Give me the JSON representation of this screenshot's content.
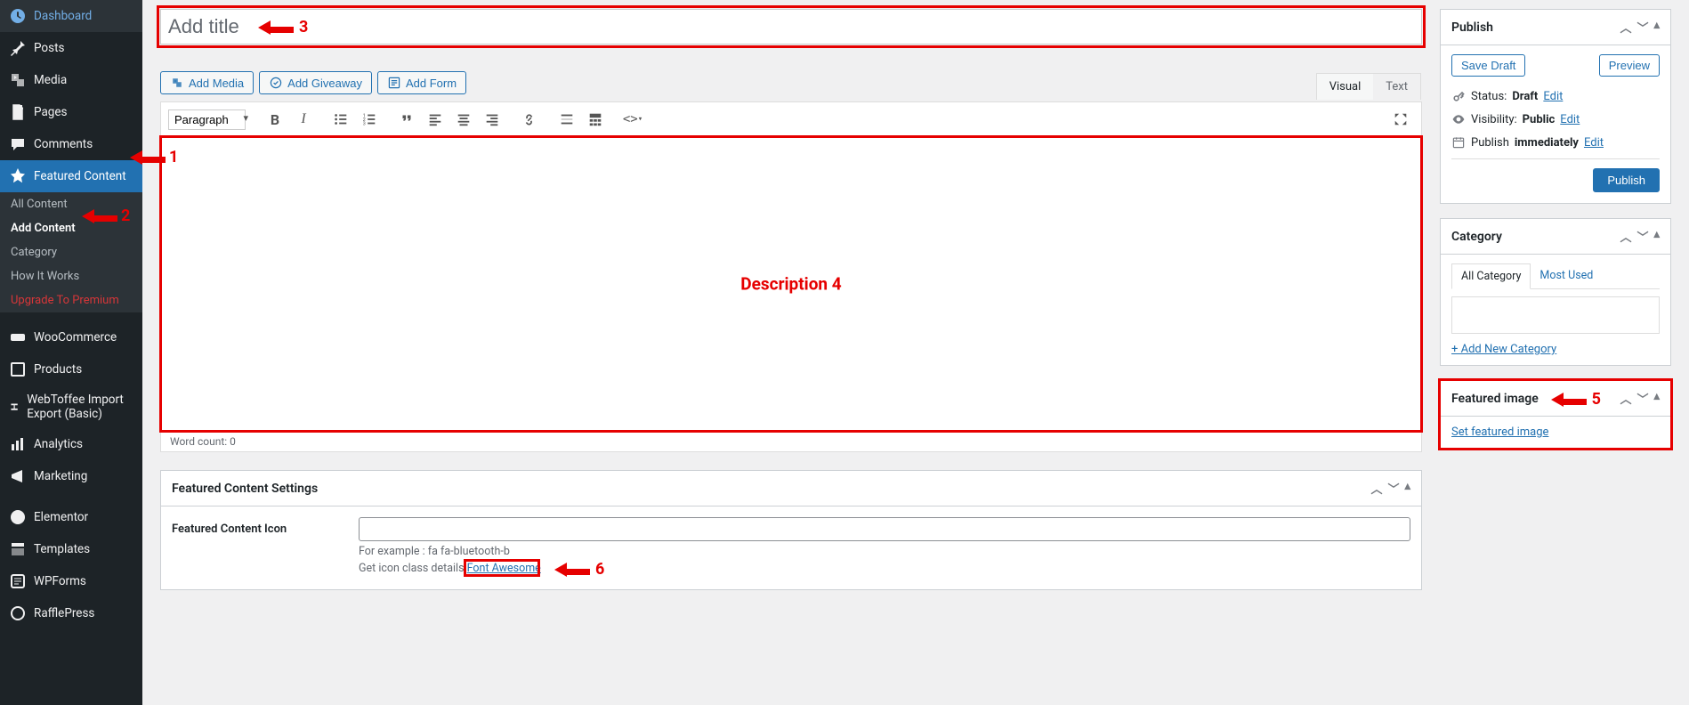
{
  "sidebar": {
    "items": [
      {
        "label": "Dashboard",
        "icon": "dashboard-icon"
      },
      {
        "label": "Posts",
        "icon": "pin-icon"
      },
      {
        "label": "Media",
        "icon": "media-icon"
      },
      {
        "label": "Pages",
        "icon": "pages-icon"
      },
      {
        "label": "Comments",
        "icon": "comments-icon"
      },
      {
        "label": "Featured Content",
        "icon": "star-icon",
        "active": true
      },
      {
        "label": "WooCommerce",
        "icon": "woo-icon"
      },
      {
        "label": "Products",
        "icon": "products-icon"
      },
      {
        "label": "WebToffee Import Export (Basic)",
        "icon": "import-icon"
      },
      {
        "label": "Analytics",
        "icon": "analytics-icon"
      },
      {
        "label": "Marketing",
        "icon": "marketing-icon"
      },
      {
        "label": "Elementor",
        "icon": "elementor-icon"
      },
      {
        "label": "Templates",
        "icon": "templates-icon"
      },
      {
        "label": "WPForms",
        "icon": "wpforms-icon"
      },
      {
        "label": "RafflePress",
        "icon": "rafflepress-icon"
      }
    ],
    "subitems": [
      {
        "label": "All Content"
      },
      {
        "label": "Add Content",
        "active": true
      },
      {
        "label": "Category"
      },
      {
        "label": "How It Works"
      },
      {
        "label": "Upgrade To Premium",
        "upgrade": true
      }
    ]
  },
  "title": {
    "placeholder": "Add title"
  },
  "mediaButtons": {
    "addMedia": "Add Media",
    "addGiveaway": "Add Giveaway",
    "addForm": "Add Form"
  },
  "editor": {
    "tabs": {
      "visual": "Visual",
      "text": "Text"
    },
    "formatSelect": "Paragraph",
    "wordCount": "Word count: 0"
  },
  "annotations": {
    "n1": "1",
    "n2": "2",
    "n3": "3",
    "n4": "Description  4",
    "n5": "5",
    "n6": "6"
  },
  "settingsBox": {
    "title": "Featured Content Settings",
    "iconLabel": "Featured Content Icon",
    "exampleText": "For example : fa fa-bluetooth-b",
    "detailText": "Get icon class details ",
    "fontAwesome": "Font Awesome"
  },
  "publish": {
    "title": "Publish",
    "saveDraft": "Save Draft",
    "preview": "Preview",
    "statusLabel": "Status:",
    "statusValue": "Draft",
    "edit": "Edit",
    "visibilityLabel": "Visibility:",
    "visibilityValue": "Public",
    "scheduleLabel": "Publish",
    "scheduleValue": "immediately",
    "publishBtn": "Publish"
  },
  "category": {
    "title": "Category",
    "tabAll": "All Category",
    "tabMost": "Most Used",
    "addNew": "+ Add New Category"
  },
  "featuredImage": {
    "title": "Featured image",
    "setLink": "Set featured image"
  }
}
